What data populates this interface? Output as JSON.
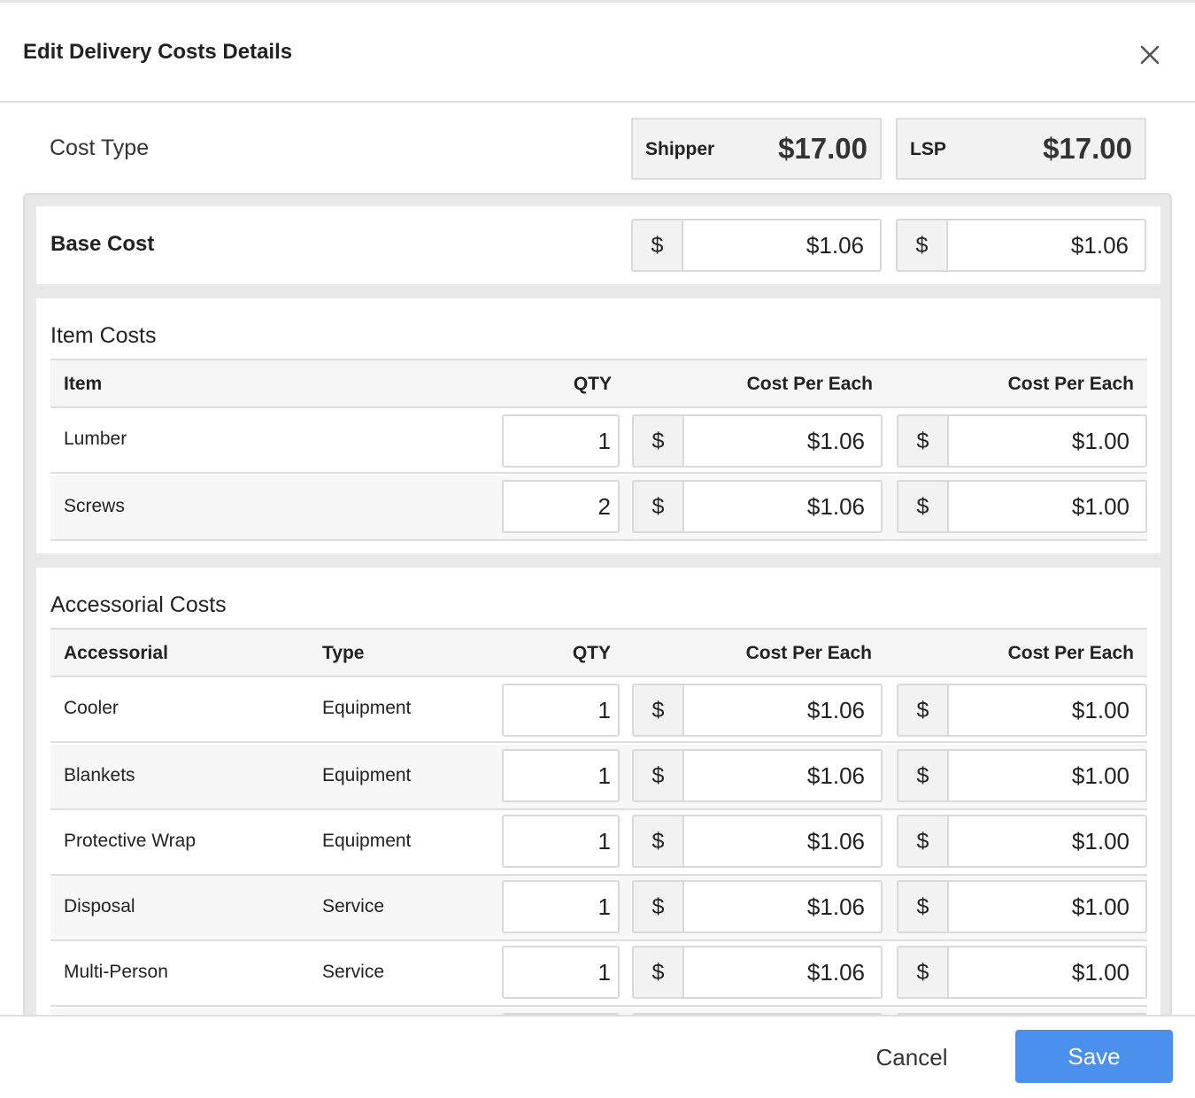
{
  "modal": {
    "title": "Edit Delivery Costs Details"
  },
  "cost_type": {
    "label": "Cost Type",
    "shipper": {
      "name": "Shipper",
      "total": "$17.00"
    },
    "lsp": {
      "name": "LSP",
      "total": "$17.00"
    }
  },
  "base_cost": {
    "label": "Base Cost",
    "currency": "$",
    "shipper_value": "$1.06",
    "lsp_value": "$1.06"
  },
  "item_costs": {
    "title": "Item Costs",
    "headers": {
      "item": "Item",
      "qty": "QTY",
      "shipper_cost": "Cost Per Each",
      "lsp_cost": "Cost Per Each"
    },
    "currency": "$",
    "rows": [
      {
        "item": "Lumber",
        "qty": "1",
        "shipper": "$1.06",
        "lsp": "$1.00"
      },
      {
        "item": "Screws",
        "qty": "2",
        "shipper": "$1.06",
        "lsp": "$1.00"
      }
    ]
  },
  "accessorial_costs": {
    "title": "Accessorial Costs",
    "headers": {
      "accessorial": "Accessorial",
      "type": "Type",
      "qty": "QTY",
      "shipper_cost": "Cost Per Each",
      "lsp_cost": "Cost Per Each"
    },
    "currency": "$",
    "rows": [
      {
        "name": "Cooler",
        "type": "Equipment",
        "qty": "1",
        "shipper": "$1.06",
        "lsp": "$1.00"
      },
      {
        "name": "Blankets",
        "type": "Equipment",
        "qty": "1",
        "shipper": "$1.06",
        "lsp": "$1.00"
      },
      {
        "name": "Protective Wrap",
        "type": "Equipment",
        "qty": "1",
        "shipper": "$1.06",
        "lsp": "$1.00"
      },
      {
        "name": "Disposal",
        "type": "Service",
        "qty": "1",
        "shipper": "$1.06",
        "lsp": "$1.00"
      },
      {
        "name": "Multi-Person",
        "type": "Service",
        "qty": "1",
        "shipper": "$1.06",
        "lsp": "$1.00"
      }
    ]
  },
  "footer": {
    "cancel_label": "Cancel",
    "save_label": "Save"
  },
  "colors": {
    "primary": "#4a90ec",
    "border": "#dedede",
    "panel_bg": "#e8e8e8"
  },
  "icons": {
    "close": "close-icon"
  }
}
